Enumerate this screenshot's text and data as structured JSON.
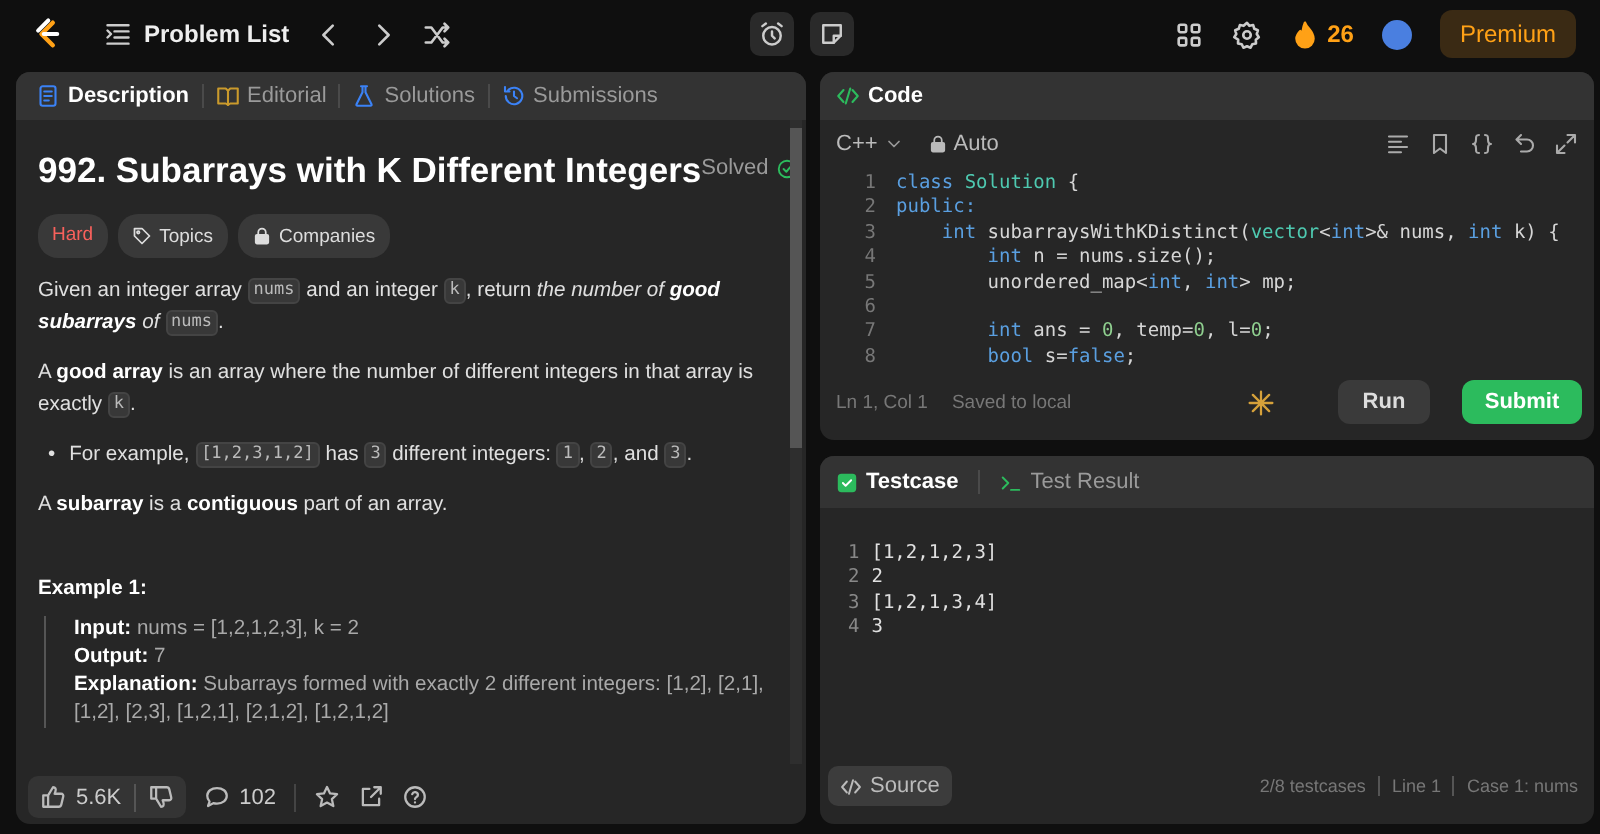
{
  "topbar": {
    "nav_title": "Problem List",
    "streak": "26",
    "premium": "Premium"
  },
  "description": {
    "tabs": [
      {
        "label": "Description",
        "selected": true
      },
      {
        "label": "Editorial",
        "selected": false
      },
      {
        "label": "Solutions",
        "selected": false
      },
      {
        "label": "Submissions",
        "selected": false
      }
    ],
    "title": "992. Subarrays with K Different Integers",
    "status": "Solved",
    "difficulty": "Hard",
    "tags": [
      {
        "label": "Topics"
      },
      {
        "label": "Companies"
      }
    ],
    "body": [
      {
        "kind": "paragraph",
        "parts": [
          {
            "kind": "text",
            "text": "Given an integer array "
          },
          {
            "kind": "code",
            "text": "nums"
          },
          {
            "kind": "text",
            "text": " and an integer "
          },
          {
            "kind": "code",
            "text": "k"
          },
          {
            "kind": "text",
            "text": ", return "
          },
          {
            "kind": "em",
            "text": "the number of **good subarrays** of "
          },
          {
            "kind": "code",
            "text": "nums"
          },
          {
            "kind": "text",
            "text": "."
          }
        ]
      },
      {
        "kind": "paragraph",
        "parts": [
          {
            "kind": "text",
            "text": "A **good array** is an array where the number of different integers in that array is exactly "
          },
          {
            "kind": "code",
            "text": "k"
          },
          {
            "kind": "text",
            "text": "."
          }
        ]
      },
      {
        "kind": "bullet",
        "marker": "•",
        "parts": [
          {
            "kind": "text",
            "text": "For example, "
          },
          {
            "kind": "code",
            "text": "[1,2,3,1,2]"
          },
          {
            "kind": "text",
            "text": " has "
          },
          {
            "kind": "code",
            "text": "3"
          },
          {
            "kind": "text",
            "text": " different integers: "
          },
          {
            "kind": "code",
            "text": "1"
          },
          {
            "kind": "text",
            "text": ", "
          },
          {
            "kind": "code",
            "text": "2"
          },
          {
            "kind": "text",
            "text": ", and "
          },
          {
            "kind": "code",
            "text": "3"
          },
          {
            "kind": "text",
            "text": "."
          }
        ]
      },
      {
        "kind": "paragraph",
        "parts": [
          {
            "kind": "text",
            "text": "A **subarray** is a **contiguous** part of an array."
          }
        ]
      }
    ],
    "example": {
      "heading": "Example 1:",
      "lines": [
        "**Input:** nums = [1,2,1,2,3], k = 2",
        "**Output:** 7",
        "**Explanation:** Subarrays formed with exactly 2 different integers: [1,2], [2,1], [1,2], [2,3], [1,2,1], [2,1,2], [1,2,1,2]"
      ]
    },
    "footer": {
      "likes": "5.6K",
      "comments": "102"
    }
  },
  "code": {
    "tab": "Code",
    "language": "C++",
    "mode": "Auto",
    "lines": [
      {
        "number": "1",
        "tokens": [
          {
            "kind": "keyword",
            "text": "class"
          },
          {
            "kind": "type",
            "text": " Solution"
          },
          {
            "kind": "plain",
            "text": " {"
          }
        ]
      },
      {
        "number": "2",
        "tokens": [
          {
            "kind": "keyword",
            "text": "public:"
          }
        ]
      },
      {
        "number": "3",
        "tokens": [
          {
            "kind": "keyword",
            "text": "    int"
          },
          {
            "kind": "plain",
            "text": " subarraysWithKDistinct("
          },
          {
            "kind": "type",
            "text": "vector"
          },
          {
            "kind": "plain",
            "text": "<"
          },
          {
            "kind": "keyword",
            "text": "int"
          },
          {
            "kind": "plain",
            "text": ">& nums, "
          },
          {
            "kind": "keyword",
            "text": "int"
          },
          {
            "kind": "plain",
            "text": " k) {"
          }
        ]
      },
      {
        "number": "4",
        "tokens": [
          {
            "kind": "keyword",
            "text": "        int"
          },
          {
            "kind": "plain",
            "text": " n = nums.size();"
          }
        ]
      },
      {
        "number": "5",
        "tokens": [
          {
            "kind": "plain",
            "text": "        unordered_map<"
          },
          {
            "kind": "keyword",
            "text": "int"
          },
          {
            "kind": "plain",
            "text": ", "
          },
          {
            "kind": "keyword",
            "text": "int"
          },
          {
            "kind": "plain",
            "text": "> mp;"
          }
        ]
      },
      {
        "number": "6"
      },
      {
        "number": "7",
        "tokens": [
          {
            "kind": "keyword",
            "text": "        int"
          },
          {
            "kind": "plain",
            "text": " ans = "
          },
          {
            "kind": "number",
            "text": "0"
          },
          {
            "kind": "plain",
            "text": ", temp="
          },
          {
            "kind": "number",
            "text": "0"
          },
          {
            "kind": "plain",
            "text": ", l="
          },
          {
            "kind": "number",
            "text": "0"
          },
          {
            "kind": "plain",
            "text": ";"
          }
        ]
      },
      {
        "number": "8",
        "tokens": [
          {
            "kind": "keyword",
            "text": "        bool"
          },
          {
            "kind": "plain",
            "text": " s="
          },
          {
            "kind": "keyword",
            "text": "false"
          },
          {
            "kind": "plain",
            "text": ";"
          }
        ]
      }
    ],
    "cursor": "Ln 1, Col 1",
    "save_status": "Saved to local",
    "run": "Run",
    "submit": "Submit"
  },
  "testcase": {
    "tabs": [
      {
        "label": "Testcase",
        "selected": true
      },
      {
        "label": "Test Result",
        "selected": false
      }
    ],
    "lines": [
      {
        "number": "1",
        "text": "[1,2,1,2,3]"
      },
      {
        "number": "2",
        "text": "2"
      },
      {
        "number": "3",
        "text": "[1,2,1,3,4]"
      },
      {
        "number": "4",
        "text": "3"
      }
    ],
    "source": "Source",
    "count": "2/8 testcases",
    "line": "Line 1",
    "case": "Case 1: nums"
  }
}
